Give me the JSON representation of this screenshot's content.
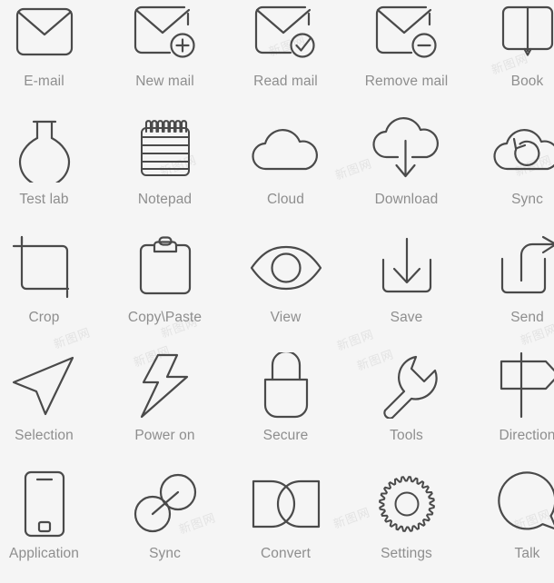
{
  "page": {
    "background_color": "#f5f5f5",
    "stroke_color": "#4a4a4a",
    "label_color": "#8e8e8e",
    "watermark_text": "新图网",
    "columns": 5,
    "rows": 5
  },
  "icons": [
    {
      "id": "email",
      "label": "E-mail",
      "icon_name": "envelope-icon"
    },
    {
      "id": "new-mail",
      "label": "New mail",
      "icon_name": "envelope-plus-icon"
    },
    {
      "id": "read-mail",
      "label": "Read mail",
      "icon_name": "envelope-check-icon"
    },
    {
      "id": "remove-mail",
      "label": "Remove mail",
      "icon_name": "envelope-minus-icon"
    },
    {
      "id": "book",
      "label": "Book",
      "icon_name": "open-book-icon"
    },
    {
      "id": "test-lab",
      "label": "Test lab",
      "icon_name": "flask-icon"
    },
    {
      "id": "notepad",
      "label": "Notepad",
      "icon_name": "spiral-notepad-icon"
    },
    {
      "id": "cloud",
      "label": "Cloud",
      "icon_name": "cloud-icon"
    },
    {
      "id": "download",
      "label": "Download",
      "icon_name": "cloud-download-icon"
    },
    {
      "id": "sync-cloud",
      "label": "Sync",
      "icon_name": "cloud-refresh-icon"
    },
    {
      "id": "crop",
      "label": "Crop",
      "icon_name": "crop-icon"
    },
    {
      "id": "copy-paste",
      "label": "Copy\\Paste",
      "icon_name": "clipboard-icon"
    },
    {
      "id": "view",
      "label": "View",
      "icon_name": "eye-icon"
    },
    {
      "id": "save",
      "label": "Save",
      "icon_name": "download-tray-icon"
    },
    {
      "id": "send",
      "label": "Send",
      "icon_name": "share-arrow-icon"
    },
    {
      "id": "selection",
      "label": "Selection",
      "icon_name": "cursor-arrow-icon"
    },
    {
      "id": "power-on",
      "label": "Power on",
      "icon_name": "lightning-bolt-icon"
    },
    {
      "id": "secure",
      "label": "Secure",
      "icon_name": "padlock-icon"
    },
    {
      "id": "tools",
      "label": "Tools",
      "icon_name": "wrench-icon"
    },
    {
      "id": "direction",
      "label": "Direction",
      "icon_name": "signpost-icon"
    },
    {
      "id": "application",
      "label": "Application",
      "icon_name": "smartphone-icon"
    },
    {
      "id": "sync-loop",
      "label": "Sync",
      "icon_name": "infinity-icon"
    },
    {
      "id": "convert",
      "label": "Convert",
      "icon_name": "bowtie-convert-icon"
    },
    {
      "id": "settings",
      "label": "Settings",
      "icon_name": "gear-icon"
    },
    {
      "id": "talk",
      "label": "Talk",
      "icon_name": "speech-bubble-icon"
    }
  ]
}
